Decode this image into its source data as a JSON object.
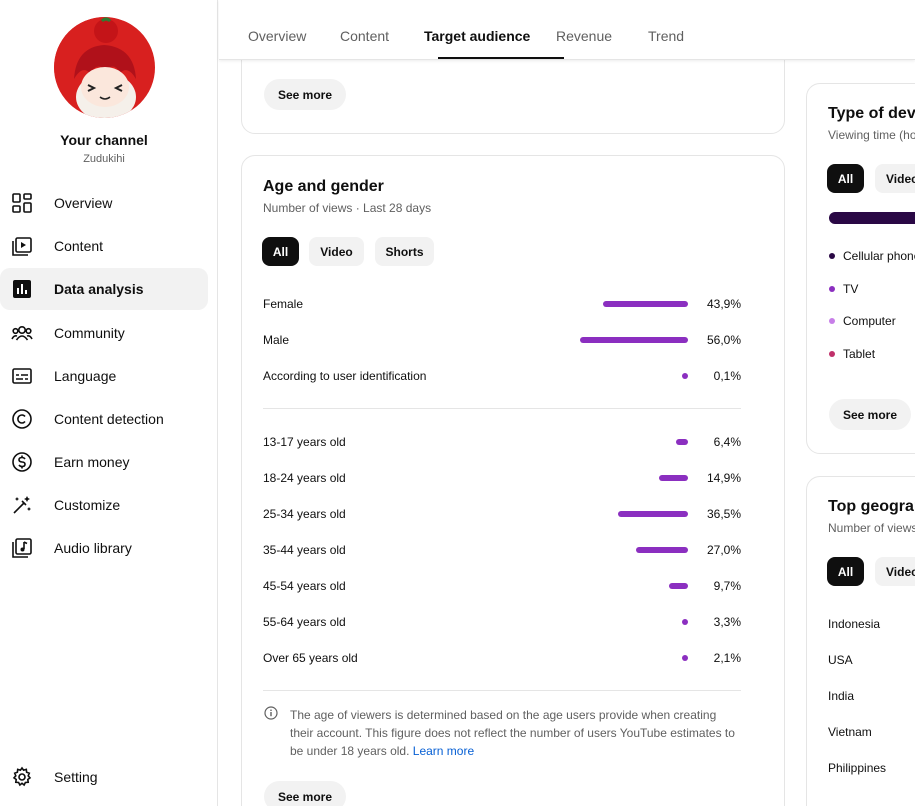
{
  "channel": {
    "name": "Your channel",
    "handle": "Zudukihi"
  },
  "sidebar": {
    "items": [
      {
        "label": "Overview",
        "icon": "overview-icon"
      },
      {
        "label": "Content",
        "icon": "content-icon"
      },
      {
        "label": "Data analysis",
        "icon": "analytics-icon",
        "active": true
      },
      {
        "label": "Community",
        "icon": "community-icon"
      },
      {
        "label": "Language",
        "icon": "language-icon"
      },
      {
        "label": "Content detection",
        "icon": "copyright-icon"
      },
      {
        "label": "Earn money",
        "icon": "dollar-icon"
      },
      {
        "label": "Customize",
        "icon": "magic-wand-icon"
      },
      {
        "label": "Audio library",
        "icon": "audio-library-icon"
      }
    ],
    "setting": "Setting"
  },
  "tabs": [
    "Overview",
    "Content",
    "Target audience",
    "Revenue",
    "Trend"
  ],
  "active_tab": "Target audience",
  "see_more": "See more",
  "age_gender": {
    "title": "Age and gender",
    "subtitle": "Number of views · Last 28 days",
    "filters": [
      "All",
      "Video",
      "Shorts"
    ],
    "gender": [
      {
        "label": "Female",
        "value": 43.9,
        "display": "43,9%"
      },
      {
        "label": "Male",
        "value": 56.0,
        "display": "56,0%"
      },
      {
        "label": "According to user identification",
        "value": 0.1,
        "display": "0,1%"
      }
    ],
    "age": [
      {
        "label": "13-17 years old",
        "value": 6.4,
        "display": "6,4%"
      },
      {
        "label": "18-24 years old",
        "value": 14.9,
        "display": "14,9%"
      },
      {
        "label": "25-34 years old",
        "value": 36.5,
        "display": "36,5%"
      },
      {
        "label": "35-44 years old",
        "value": 27.0,
        "display": "27,0%"
      },
      {
        "label": "45-54 years old",
        "value": 9.7,
        "display": "9,7%"
      },
      {
        "label": "55-64 years old",
        "value": 3.3,
        "display": "3,3%"
      },
      {
        "label": "Over 65 years old",
        "value": 2.1,
        "display": "2,1%"
      }
    ],
    "note_text": "The age of viewers is determined based on the age users provide when creating their account. This figure does not reflect the number of users YouTube estimates to be under 18 years old.",
    "note_link": "Learn more"
  },
  "device_type": {
    "title": "Type of devi",
    "subtitle": "Viewing time (ho",
    "filters": [
      "All",
      "Videc"
    ],
    "legend": [
      {
        "label": "Cellular phone",
        "color": "#2a0845"
      },
      {
        "label": "TV",
        "color": "#8b2fc0"
      },
      {
        "label": "Computer",
        "color": "#c77ee8"
      },
      {
        "label": "Tablet",
        "color": "#c0306a"
      }
    ]
  },
  "geography": {
    "title": "Top geograp",
    "subtitle": "Number of views",
    "filters": [
      "All",
      "Videc"
    ],
    "countries": [
      "Indonesia",
      "USA",
      "India",
      "Vietnam",
      "Philippines"
    ]
  },
  "colors": {
    "accent_bar": "#8b2fc0",
    "chip_selected": "#0f0f0f",
    "link": "#065fd4"
  }
}
